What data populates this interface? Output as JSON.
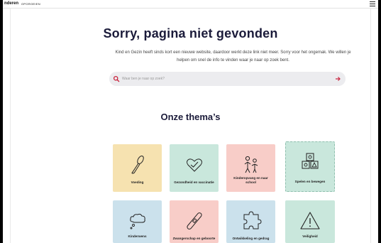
{
  "header": {
    "brand": "nderen",
    "link": "OPGROEIEN"
  },
  "page_title": "Sorry, pagina niet gevonden",
  "intro_text": "Kind en Gezin heeft sinds kort een nieuwe website, daardoor werkt deze link niet meer. Sorry voor het ongemak. We willen je helpen om snel de info te vinden waar je naar op zoek bent.",
  "search": {
    "placeholder": "Waar ben je naar op zoek?"
  },
  "themes_title": "Onze thema’s",
  "themes": [
    {
      "label": "Voeding",
      "icon": "spoon-icon",
      "color": "#f6e2b0"
    },
    {
      "label": "Gezondheid en vaccinatie",
      "icon": "heart-check-icon",
      "color": "#c9e7dc"
    },
    {
      "label": "Kinderopvang en naar school",
      "icon": "children-icon",
      "color": "#f8cdc8"
    },
    {
      "label": "Spelen en bewegen",
      "icon": "blocks-icon",
      "color": "#c9e7dc"
    },
    {
      "label": "Kinderwens",
      "icon": "thought-cloud-icon",
      "color": "#cbe1ec"
    },
    {
      "label": "Zwangerschap en geboorte",
      "icon": "pregnancy-test-icon",
      "color": "#f8cdc8"
    },
    {
      "label": "Ontwikkeling en gedrag",
      "icon": "puzzle-icon",
      "color": "#cbe1ec"
    },
    {
      "label": "Veiligheid",
      "icon": "warning-icon",
      "color": "#c9e7dc"
    }
  ],
  "colors": {
    "title": "#1b1b3a",
    "accent": "#c9223c",
    "search_bg": "#ececef"
  }
}
